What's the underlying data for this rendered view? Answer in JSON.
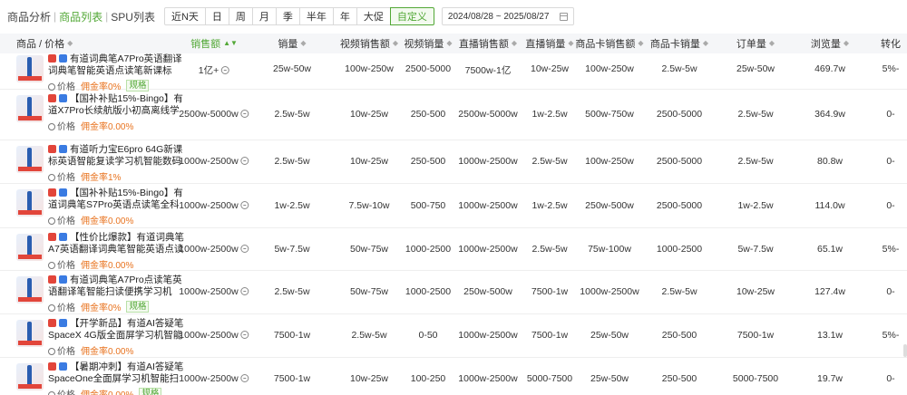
{
  "nav": {
    "tabs": [
      "商品分析",
      "商品列表",
      "SPU列表"
    ],
    "active": 1
  },
  "ranges": [
    "近N天",
    "日",
    "周",
    "月",
    "季",
    "半年",
    "年",
    "大促",
    "自定义"
  ],
  "range_active": 8,
  "date_range": "2024/08/28 ~ 2025/08/27",
  "columns": [
    {
      "label": "商品 / 价格",
      "sort": "◆"
    },
    {
      "label": "销售额",
      "sort": "▲▼"
    },
    {
      "label": "销量",
      "sort": "◆"
    },
    {
      "label": "视频销售额",
      "sort": "◆"
    },
    {
      "label": "视频销量",
      "sort": "◆"
    },
    {
      "label": "直播销售额",
      "sort": "◆"
    },
    {
      "label": "直播销量",
      "sort": "◆"
    },
    {
      "label": "商品卡销售额",
      "sort": "◆"
    },
    {
      "label": "商品卡销量",
      "sort": "◆"
    },
    {
      "label": "订单量",
      "sort": "◆"
    },
    {
      "label": "浏览量",
      "sort": "◆"
    },
    {
      "label": "转化",
      "sort": ""
    }
  ],
  "rows": [
    {
      "name": "有道词典笔A7Pro英语翻译词典笔智能英语点读笔新课标",
      "price": "价格",
      "commission": "佣金率0%",
      "spec": "规格",
      "v": [
        "1亿+",
        "25w-50w",
        "100w-250w",
        "2500-5000",
        "7500w-1亿",
        "10w-25w",
        "100w-250w",
        "2.5w-5w",
        "25w-50w",
        "469.7w",
        "5%-"
      ]
    },
    {
      "name": "【国补补贴15%-Bingo】有道X7Pro长续航版小初高离线学习笔翻…",
      "price": "价格",
      "commission": "佣金率0.00%",
      "spec": "",
      "v": [
        "2500w-5000w",
        "2.5w-5w",
        "10w-25w",
        "250-500",
        "2500w-5000w",
        "1w-2.5w",
        "500w-750w",
        "2500-5000",
        "2.5w-5w",
        "364.9w",
        "0-"
      ]
    },
    {
      "name": "有道听力宝E6pro 64G新课标英语智能复读学习机智能数码好物",
      "price": "价格",
      "commission": "佣金率1%",
      "spec": "",
      "v": [
        "1000w-2500w",
        "2.5w-5w",
        "10w-25w",
        "250-500",
        "1000w-2500w",
        "2.5w-5w",
        "100w-250w",
        "2500-5000",
        "2.5w-5w",
        "80.8w",
        "0-"
      ]
    },
    {
      "name": "【国补补贴15%-Bingo】有道词典笔S7Pro英语点读笔全科视频…",
      "price": "价格",
      "commission": "佣金率0.00%",
      "spec": "",
      "v": [
        "1000w-2500w",
        "1w-2.5w",
        "7.5w-10w",
        "500-750",
        "1000w-2500w",
        "1w-2.5w",
        "250w-500w",
        "2500-5000",
        "1w-2.5w",
        "114.0w",
        "0-"
      ]
    },
    {
      "name": "【性价比爆款】有道词典笔A7英语翻译词典笔智能英语点读笔…",
      "price": "价格",
      "commission": "佣金率0.00%",
      "spec": "",
      "v": [
        "1000w-2500w",
        "5w-7.5w",
        "50w-75w",
        "1000-2500",
        "1000w-2500w",
        "2.5w-5w",
        "75w-100w",
        "1000-2500",
        "5w-7.5w",
        "65.1w",
        "5%-"
      ]
    },
    {
      "name": "有道词典笔A7Pro点读笔英语翻译笔智能扫读便携学习机",
      "price": "价格",
      "commission": "佣金率0%",
      "spec": "规格",
      "v": [
        "1000w-2500w",
        "2.5w-5w",
        "50w-75w",
        "1000-2500",
        "250w-500w",
        "7500-1w",
        "1000w-2500w",
        "2.5w-5w",
        "10w-25w",
        "127.4w",
        "0-"
      ]
    },
    {
      "name": "【开学新品】有道AI答疑笔SpaceX 4G版全面屏学习机智能英语…",
      "price": "价格",
      "commission": "佣金率0.00%",
      "spec": "",
      "v": [
        "1000w-2500w",
        "7500-1w",
        "2.5w-5w",
        "0-50",
        "1000w-2500w",
        "7500-1w",
        "25w-50w",
        "250-500",
        "7500-1w",
        "13.1w",
        "5%-"
      ]
    },
    {
      "name": "【暑期冲刺】有道AI答疑笔SpaceOne全面屏学习机智能扫读英语…",
      "price": "价格",
      "commission": "佣金率0.00%",
      "spec": "规格",
      "v": [
        "1000w-2500w",
        "7500-1w",
        "10w-25w",
        "100-250",
        "1000w-2500w",
        "5000-7500",
        "25w-50w",
        "250-500",
        "5000-7500",
        "19.7w",
        "0-"
      ]
    }
  ],
  "colors": {
    "accent": "#52a836",
    "commission": "#e8731f",
    "header_bg": "#f5f6f8"
  }
}
